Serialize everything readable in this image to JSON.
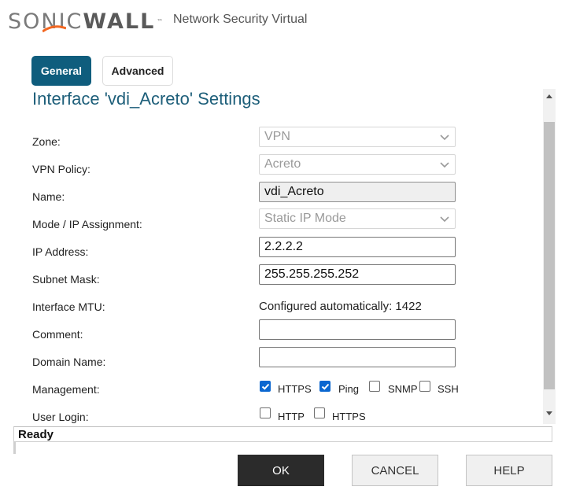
{
  "header": {
    "logo_part1": "SONIC",
    "logo_part2": "WALL",
    "logo_tm": "™",
    "product": "Network Security Virtual",
    "accent_color": "#f26722"
  },
  "tabs": [
    {
      "label": "General",
      "active": true
    },
    {
      "label": "Advanced",
      "active": false
    }
  ],
  "title": "Interface 'vdi_Acreto' Settings",
  "form": {
    "zone": {
      "label": "Zone:",
      "value": "VPN"
    },
    "vpn_policy": {
      "label": "VPN Policy:",
      "value": "Acreto"
    },
    "name": {
      "label": "Name:",
      "value": "vdi_Acreto"
    },
    "mode": {
      "label": "Mode / IP Assignment:",
      "value": "Static IP Mode"
    },
    "ip_address": {
      "label": "IP Address:",
      "value": "2.2.2.2"
    },
    "subnet_mask": {
      "label": "Subnet Mask:",
      "value": "255.255.255.252"
    },
    "mtu": {
      "label": "Interface MTU:",
      "value": "Configured automatically: 1422"
    },
    "comment": {
      "label": "Comment:",
      "value": ""
    },
    "domain_name": {
      "label": "Domain Name:",
      "value": ""
    },
    "management": {
      "label": "Management:",
      "options": [
        {
          "label": "HTTPS",
          "checked": true
        },
        {
          "label": "Ping",
          "checked": true
        },
        {
          "label": "SNMP",
          "checked": false
        },
        {
          "label": "SSH",
          "checked": false
        }
      ]
    },
    "user_login": {
      "label": "User Login:",
      "options": [
        {
          "label": "HTTP",
          "checked": false
        },
        {
          "label": "HTTPS",
          "checked": false
        }
      ]
    }
  },
  "status": "Ready",
  "buttons": {
    "ok": "OK",
    "cancel": "CANCEL",
    "help": "HELP"
  }
}
